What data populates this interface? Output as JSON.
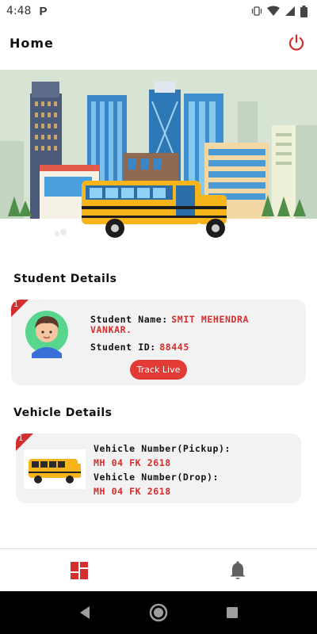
{
  "status_bar": {
    "time": "4:48",
    "app_indicator": "P",
    "icons": [
      "vibrate-icon",
      "wifi-icon",
      "signal-icon",
      "battery-icon"
    ]
  },
  "header": {
    "title": "Home",
    "power_icon": "power-icon"
  },
  "hero": {
    "illustration": "city-school-bus-illustration"
  },
  "student_section": {
    "title": "Student Details",
    "badge": "1",
    "name_label": "Student Name:",
    "name_value_line1": "SMIT MEHENDRA",
    "name_value_line2": "VANKAR.",
    "id_label": "Student ID:",
    "id_value": "88445",
    "track_button": "Track Live"
  },
  "vehicle_section": {
    "title": "Vehicle Details",
    "badge": "1",
    "pickup_label": "Vehicle Number(Pickup):",
    "pickup_value": "MH 04 FK 2618",
    "drop_label": "Vehicle Number(Drop):",
    "drop_value": "MH 04 FK 2618"
  },
  "bottom_nav": {
    "items": [
      "dashboard-icon",
      "notification-bell-icon"
    ],
    "active_color": "#d32f2f"
  },
  "colors": {
    "accent": "#d32f2f",
    "button": "#e23b35",
    "card": "#f2f2f2",
    "hero_bg": "#d7e4d4"
  }
}
